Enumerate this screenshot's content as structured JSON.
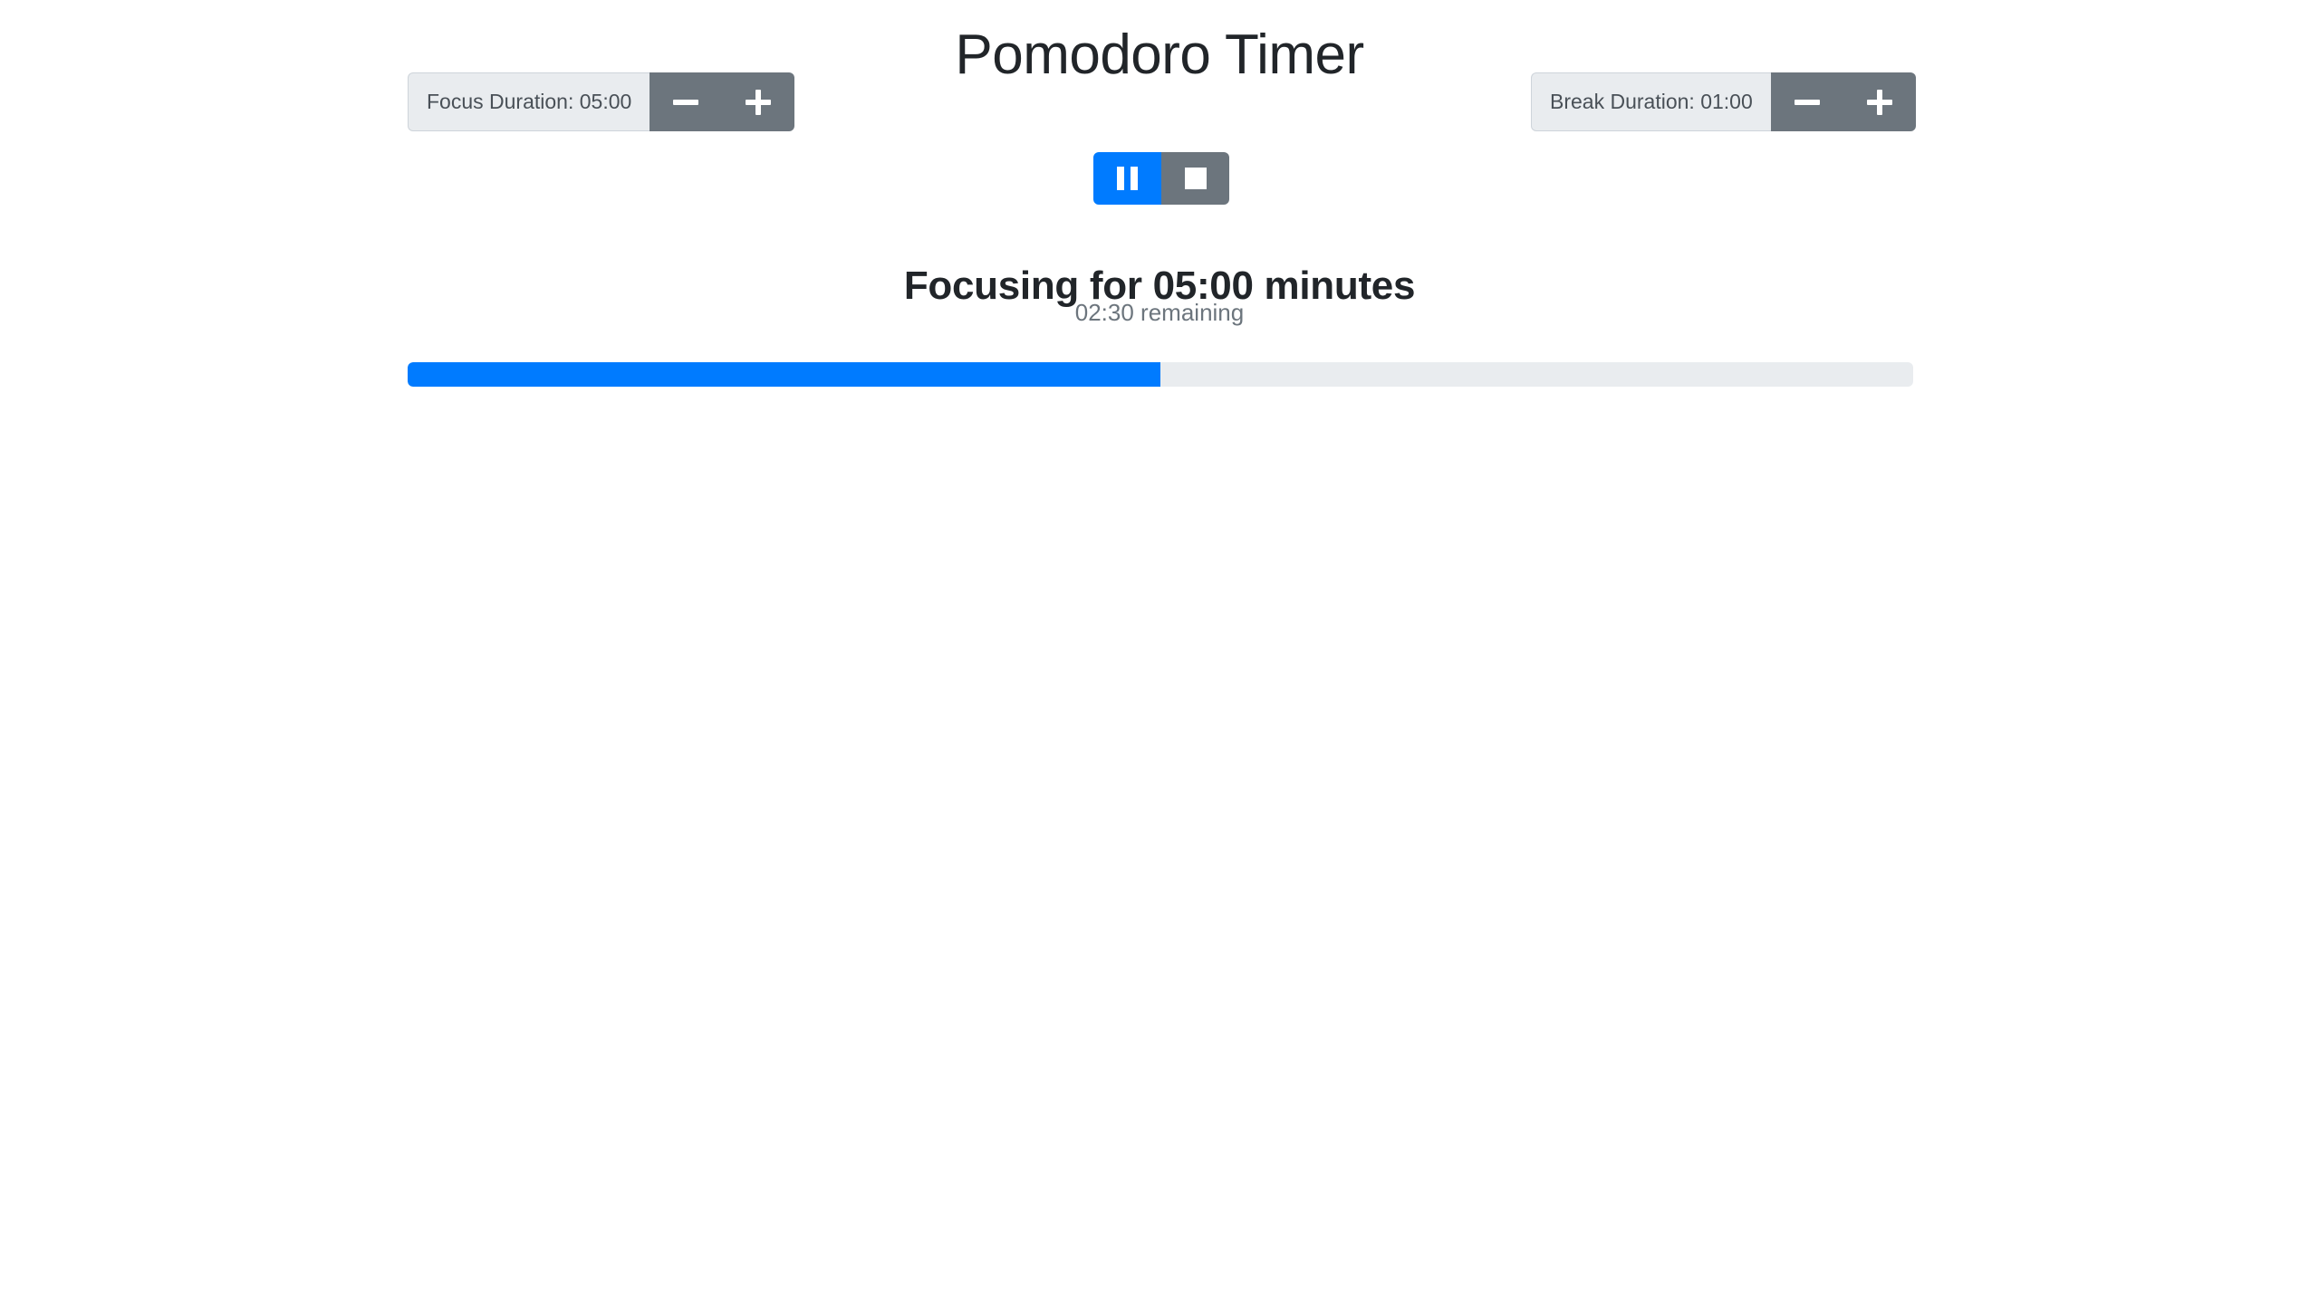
{
  "app": {
    "title": "Pomodoro Timer"
  },
  "colors": {
    "accent_blue": "#007bff",
    "secondary_gray": "#6c757d",
    "track_gray": "#e9ecef",
    "label_bg": "#e9ecef",
    "text_dark": "#212529",
    "text_muted": "#6c757d"
  },
  "focus_stepper": {
    "label": "Focus Duration: 05:00",
    "value": "05:00",
    "decrease_icon": "minus-icon",
    "increase_icon": "plus-icon"
  },
  "break_stepper": {
    "label": "Break Duration: 01:00",
    "value": "01:00",
    "decrease_icon": "minus-icon",
    "increase_icon": "plus-icon"
  },
  "transport": {
    "play_pause_icon": "pause-icon",
    "stop_icon": "stop-icon",
    "state": "running"
  },
  "status": {
    "heading": "Focusing for 05:00 minutes",
    "remaining": "02:30 remaining"
  },
  "progress": {
    "percent": 50
  }
}
